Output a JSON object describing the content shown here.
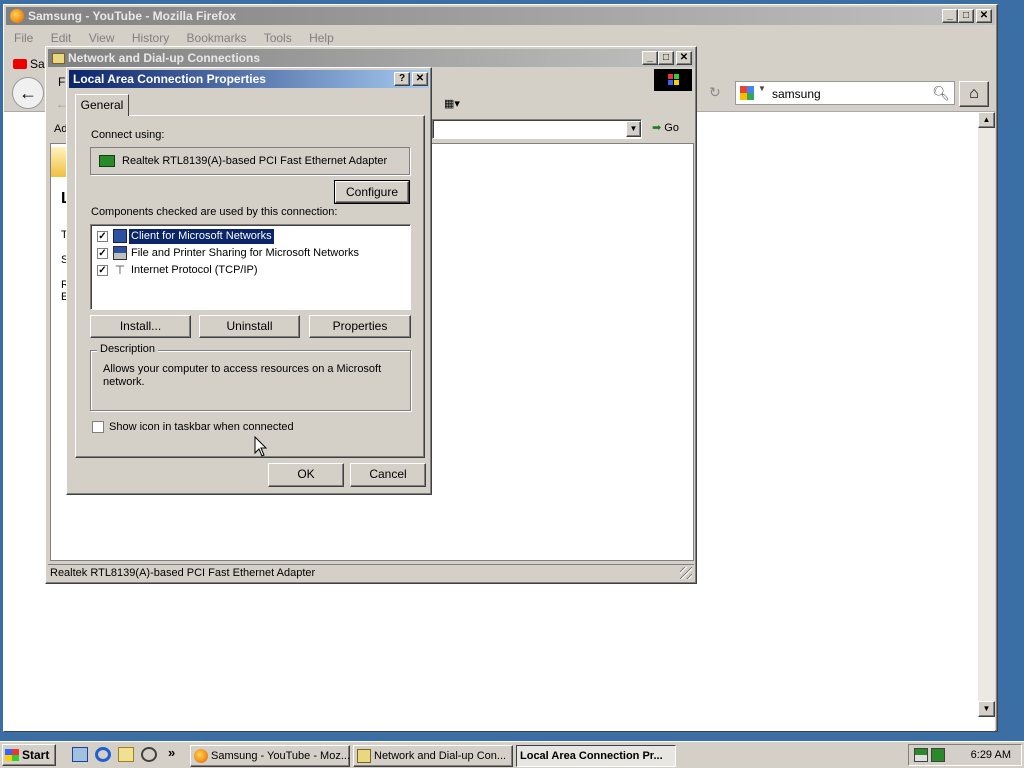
{
  "firefox": {
    "title": "Samsung - YouTube - Mozilla Firefox",
    "menu": [
      "File",
      "Edit",
      "View",
      "History",
      "Bookmarks",
      "Tools",
      "Help"
    ],
    "tab_label": "Sa",
    "search_value": "samsung"
  },
  "netconn": {
    "title": "Network and Dial-up Connections",
    "menu_fragment": "Fi",
    "address_fragment": "Ad",
    "go_label": "Go",
    "status_text": "Realtek RTL8139(A)-based PCI Fast Ethernet Adapter",
    "left_text_fragments": [
      "L",
      "T",
      "S",
      "R",
      "E"
    ]
  },
  "dialog": {
    "title": "Local Area Connection Properties",
    "tab": "General",
    "connect_using_label": "Connect using:",
    "adapter_name": "Realtek RTL8139(A)-based PCI Fast Ethernet Adapter",
    "configure_label": "Configure",
    "components_label": "Components checked are used by this connection:",
    "components": [
      {
        "label": "Client for Microsoft Networks",
        "checked": true,
        "selected": true,
        "icon": "network-client-icon"
      },
      {
        "label": "File and Printer Sharing for Microsoft Networks",
        "checked": true,
        "selected": false,
        "icon": "file-printer-sharing-icon"
      },
      {
        "label": "Internet Protocol (TCP/IP)",
        "checked": true,
        "selected": false,
        "icon": "protocol-icon"
      }
    ],
    "install_label": "Install...",
    "uninstall_label": "Uninstall",
    "properties_label": "Properties",
    "description_title": "Description",
    "description_text": "Allows your computer to access resources on a Microsoft network.",
    "show_icon_label": "Show icon in taskbar when connected",
    "show_icon_checked": false,
    "ok_label": "OK",
    "cancel_label": "Cancel"
  },
  "taskbar": {
    "start_label": "Start",
    "overflow_label": "»",
    "tasks": [
      {
        "label": "Samsung - YouTube - Moz...",
        "icon": "firefox-icon",
        "active": false
      },
      {
        "label": "Network and Dial-up Con...",
        "icon": "network-folder-icon",
        "active": false
      },
      {
        "label": "Local Area Connection Pr...",
        "icon": "",
        "active": true
      }
    ],
    "clock": "6:29 AM"
  },
  "colors": {
    "desktop": "#3a6ea5",
    "active_title": "#0a246a",
    "inactive_title": "#808080",
    "face": "#d4d0c8",
    "selection": "#0a246a"
  }
}
